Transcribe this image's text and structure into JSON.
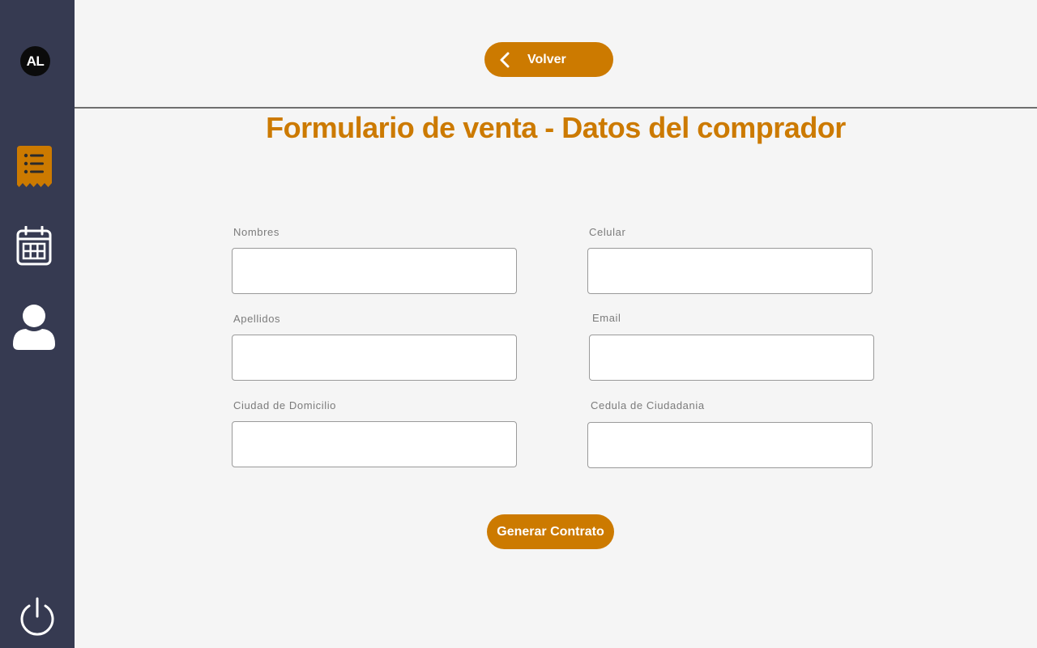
{
  "sidebar": {
    "logo_text": "AL",
    "items": [
      {
        "icon": "list-icon",
        "active": true
      },
      {
        "icon": "calendar-icon",
        "active": false
      },
      {
        "icon": "user-icon",
        "active": false
      }
    ],
    "logout_icon": "power-icon"
  },
  "header": {
    "back_label": "Volver",
    "title": "Formulario de venta - Datos del comprador"
  },
  "form": {
    "nombres": {
      "label": "Nombres",
      "value": ""
    },
    "apellidos": {
      "label": "Apellidos",
      "value": ""
    },
    "ciudad": {
      "label": "Ciudad de Domicilio",
      "value": ""
    },
    "celular": {
      "label": "Celular",
      "value": ""
    },
    "email": {
      "label": "Email",
      "value": ""
    },
    "cedula": {
      "label": "Cedula de Ciudadania",
      "value": ""
    },
    "submit_label": "Generar Contrato"
  },
  "colors": {
    "accent": "#cc7a00",
    "sidebar": "#363a51",
    "background": "#f5f5f5"
  }
}
